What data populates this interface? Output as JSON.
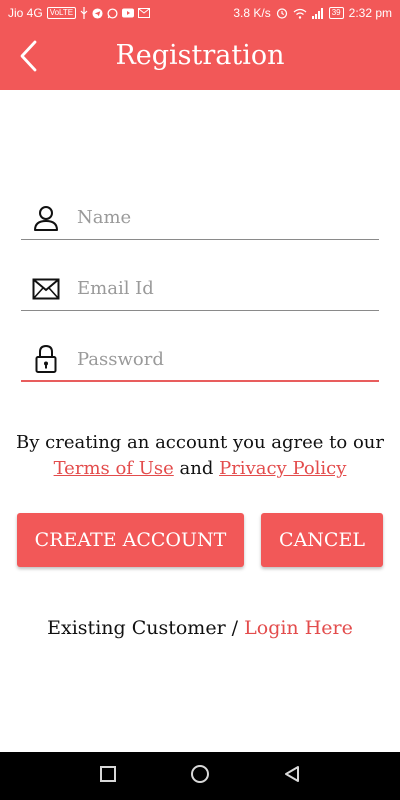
{
  "status_bar": {
    "carrier": "Jio 4G",
    "volte_badge": "VoLTE",
    "speed": "3.8 K/s",
    "battery": "39",
    "time": "2:32 pm",
    "icons": [
      "usb-icon",
      "telegram-icon",
      "whatsapp-icon",
      "youtube-icon",
      "gmail-icon",
      "alarm-icon",
      "wifi-icon",
      "signal-icon",
      "battery-icon"
    ]
  },
  "header": {
    "title": "Registration",
    "back_icon": "chevron-left-icon"
  },
  "form": {
    "name_placeholder": "Name",
    "email_placeholder": "Email Id",
    "password_placeholder": "Password",
    "icons": [
      "user-icon",
      "envelope-icon",
      "lock-icon"
    ]
  },
  "agreement": {
    "text": "By creating an account you agree to our",
    "terms": "Terms of Use",
    "and": "and",
    "privacy": "Privacy Policy"
  },
  "actions": {
    "create": "CREATE ACCOUNT",
    "cancel": "CANCEL"
  },
  "footer": {
    "existing": "Existing Customer /",
    "login": "Login Here"
  },
  "colors": {
    "brand": "#f25858",
    "link": "#e34c4c",
    "navbar": "#000000"
  }
}
